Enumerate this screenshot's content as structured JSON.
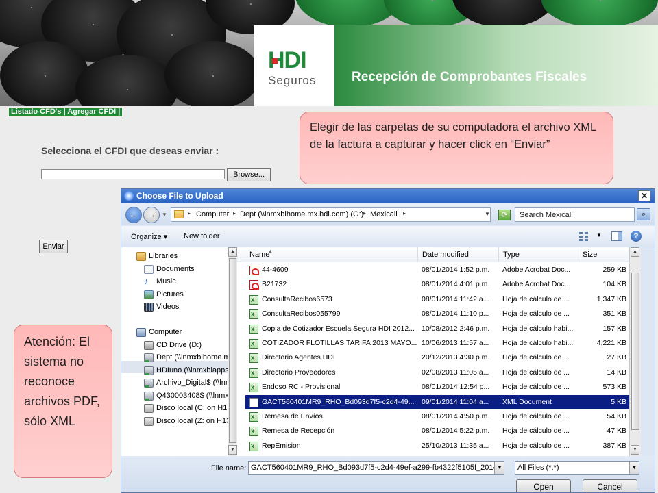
{
  "banner": {
    "brand": "HDI",
    "brand_sub": "Seguros",
    "title": "Recepción de Comprobantes Fiscales"
  },
  "nav_bar": {
    "list_link": "Listado CFD's",
    "separator": "|",
    "add_link": "Agregar CFDI",
    "end": "|"
  },
  "form": {
    "select_label": "Selecciona el CFDI que deseas enviar :",
    "browse_label": "Browse...",
    "send_label": "Enviar"
  },
  "callouts": {
    "top": "Elegir de las carpetas de su computadora el archivo XML de la factura a capturar y hacer click en “Enviar”",
    "left": "Atención: El sistema no reconoce archivos PDF, sólo XML"
  },
  "dialog": {
    "title": "Choose File to Upload",
    "breadcrumb": [
      "Computer",
      "Dept (\\\\lnmxblhome.mx.hdi.com) (G:)",
      "Mexicali"
    ],
    "search_placeholder": "Search Mexicali",
    "toolbar": {
      "organize": "Organize ▾",
      "new_folder": "New folder"
    },
    "nav_items": [
      {
        "label": "Libraries",
        "icon": "library-icon"
      },
      {
        "label": "Documents",
        "icon": "documents-icon"
      },
      {
        "label": "Music",
        "icon": "music-icon"
      },
      {
        "label": "Pictures",
        "icon": "pictures-icon"
      },
      {
        "label": "Videos",
        "icon": "videos-icon"
      },
      {
        "label": "Computer",
        "icon": "computer-icon"
      },
      {
        "label": "CD Drive (D:)",
        "icon": "cd-drive-icon"
      },
      {
        "label": "Dept (\\\\lnmxblhome.m",
        "icon": "network-drive-icon"
      },
      {
        "label": "HDIuno (\\\\lnmxblapps",
        "icon": "network-drive-icon"
      },
      {
        "label": "Archivo_Digital$ (\\\\lnm",
        "icon": "network-drive-icon"
      },
      {
        "label": "Q430003408$ (\\\\lnmx",
        "icon": "network-drive-icon"
      },
      {
        "label": "Disco local (C: on H13",
        "icon": "local-disk-icon"
      },
      {
        "label": "Disco local (Z: on H13",
        "icon": "local-disk-icon"
      }
    ],
    "columns": [
      "Name",
      "Date modified",
      "Type",
      "Size"
    ],
    "files": [
      {
        "name": "44-4609",
        "date": "08/01/2014 1:52 p.m.",
        "type": "Adobe Acrobat Doc...",
        "size": "259 KB",
        "icon": "pdf"
      },
      {
        "name": "B21732",
        "date": "08/01/2014 4:01 p.m.",
        "type": "Adobe Acrobat Doc...",
        "size": "104 KB",
        "icon": "pdf"
      },
      {
        "name": "ConsultaRecibos6573",
        "date": "08/01/2014 11:42 a...",
        "type": "Hoja de cálculo de ...",
        "size": "1,347 KB",
        "icon": "xls"
      },
      {
        "name": "ConsultaRecibos055799",
        "date": "08/01/2014 11:10 p...",
        "type": "Hoja de cálculo de ...",
        "size": "351 KB",
        "icon": "xls"
      },
      {
        "name": "Copia de Cotizador Escuela Segura HDI 2012...",
        "date": "10/08/2012 2:46 p.m.",
        "type": "Hoja de cálculo habi...",
        "size": "157 KB",
        "icon": "xls"
      },
      {
        "name": "COTIZADOR FLOTILLAS TARIFA 2013 MAYO...",
        "date": "10/06/2013 11:57 a...",
        "type": "Hoja de cálculo habi...",
        "size": "4,221 KB",
        "icon": "xls"
      },
      {
        "name": "Directorio Agentes HDI",
        "date": "20/12/2013 4:30 p.m.",
        "type": "Hoja de cálculo de ...",
        "size": "27 KB",
        "icon": "xls"
      },
      {
        "name": "Directorio Proveedores",
        "date": "02/08/2013 11:05 a...",
        "type": "Hoja de cálculo de ...",
        "size": "14 KB",
        "icon": "xls"
      },
      {
        "name": "Endoso RC - Provisional",
        "date": "08/01/2014 12:54 p...",
        "type": "Hoja de cálculo de ...",
        "size": "573 KB",
        "icon": "xls"
      },
      {
        "name": "GACT560401MR9_RHO_Bd093d7f5-c2d4-49...",
        "date": "09/01/2014 11:04 a...",
        "type": "XML Document",
        "size": "5 KB",
        "icon": "xml"
      },
      {
        "name": "Remesa de Envíos",
        "date": "08/01/2014 4:50 p.m.",
        "type": "Hoja de cálculo de ...",
        "size": "54 KB",
        "icon": "xls"
      },
      {
        "name": "Remesa de Recepción",
        "date": "08/01/2014 5:22 p.m.",
        "type": "Hoja de cálculo de ...",
        "size": "47 KB",
        "icon": "xls"
      },
      {
        "name": "RepEmision",
        "date": "25/10/2013 11:35 a...",
        "type": "Hoja de cálculo de ...",
        "size": "387 KB",
        "icon": "xls"
      }
    ],
    "selected_file_index": 9,
    "file_name_label": "File name:",
    "file_name_value": "GACT560401MR9_RHO_Bd093d7f5-c2d4-49ef-a299-fb4322f5105f_2014",
    "file_type_value": "All Files (*.*)",
    "open_label": "Open",
    "cancel_label": "Cancel"
  },
  "colors": {
    "brand_green": "#1f8a3a",
    "brand_red": "#e12626",
    "callout_fill": "#ffb8b8",
    "selection": "#0b1e83"
  }
}
